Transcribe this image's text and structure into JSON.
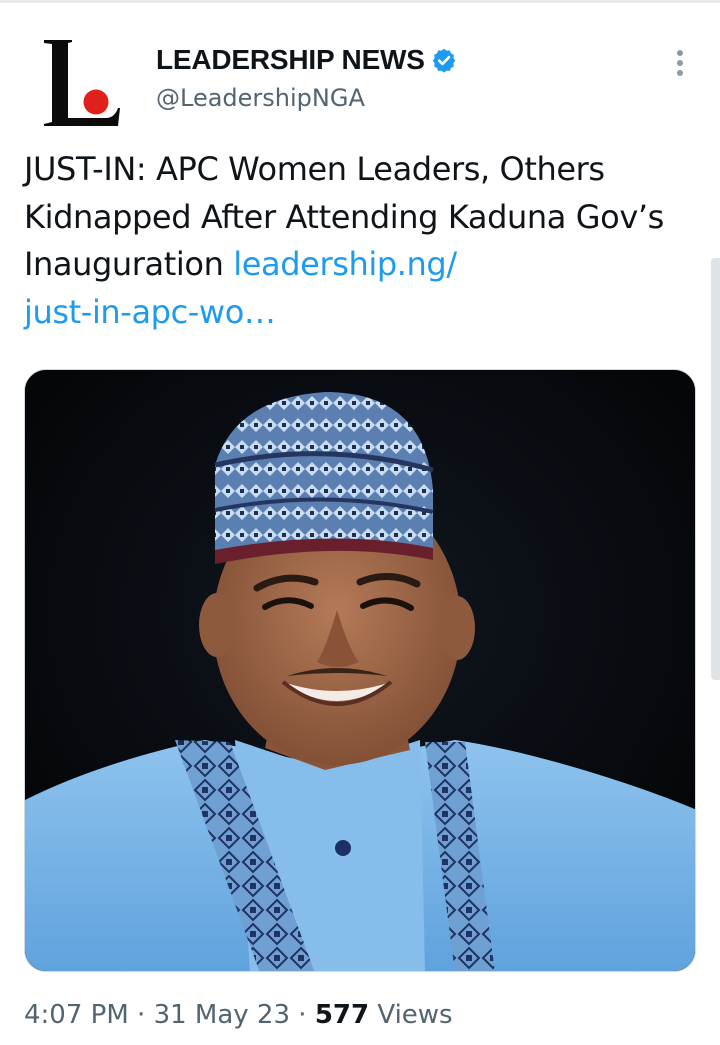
{
  "account": {
    "display_name": "LEADERSHIP NEWS",
    "handle": "@LeadershipNGA",
    "verified": true,
    "avatar_icon": "leadership-logo-icon",
    "logo_letter": "L"
  },
  "tweet": {
    "text": "JUST-IN: APC Women Leaders, Others Kidnapped After Attending Kaduna Gov’s Inauguration ",
    "link_line1": "leadership.ng/",
    "link_line2": "just-in-apc-wo…",
    "media_alt": "photo-of-smiling-man-in-blue-cap-and-robe"
  },
  "meta": {
    "time": "4:07 PM",
    "separator": "·",
    "date": "31 May 23",
    "views_count": "577",
    "views_label": "Views"
  },
  "colors": {
    "link": "#1d9bf0",
    "verified_badge": "#1d9bf0",
    "secondary_text": "#536471",
    "logo_dot": "#e0201b"
  },
  "icons": {
    "more": "more-vertical-icon",
    "verified": "verified-badge-icon"
  }
}
